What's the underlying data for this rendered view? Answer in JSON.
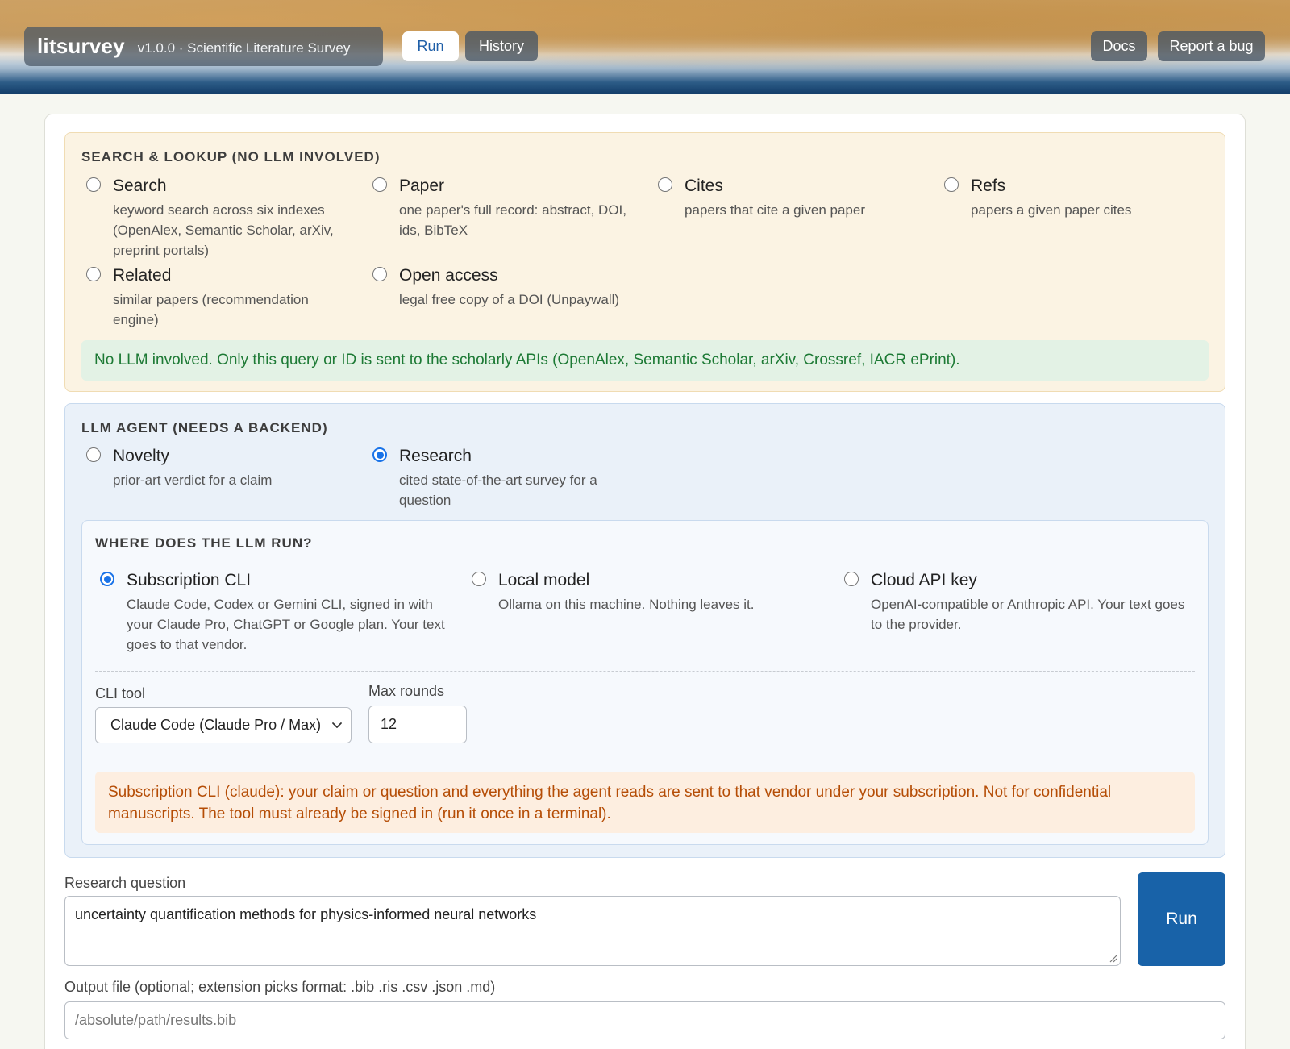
{
  "header": {
    "brand_name": "litsurvey",
    "brand_sub": "v1.0.0 · Scientific Literature Survey",
    "tabs": [
      {
        "label": "Run",
        "active": true
      },
      {
        "label": "History",
        "active": false
      }
    ],
    "links": [
      {
        "label": "Docs"
      },
      {
        "label": "Report a bug"
      }
    ]
  },
  "search_section": {
    "title": "SEARCH & LOOKUP (NO LLM INVOLVED)",
    "options": [
      {
        "label": "Search",
        "desc": "keyword search across six indexes (OpenAlex, Semantic Scholar, arXiv, preprint portals)",
        "checked": false
      },
      {
        "label": "Paper",
        "desc": "one paper's full record: abstract, DOI, ids, BibTeX",
        "checked": false
      },
      {
        "label": "Cites",
        "desc": "papers that cite a given paper",
        "checked": false
      },
      {
        "label": "Refs",
        "desc": "papers a given paper cites",
        "checked": false
      },
      {
        "label": "Related",
        "desc": "similar papers (recommendation engine)",
        "checked": false
      },
      {
        "label": "Open access",
        "desc": "legal free copy of a DOI (Unpaywall)",
        "checked": false
      }
    ],
    "note": "No LLM involved. Only this query or ID is sent to the scholarly APIs (OpenAlex, Semantic Scholar, arXiv, Crossref, IACR ePrint)."
  },
  "llm_section": {
    "title": "LLM AGENT (NEEDS A BACKEND)",
    "options": [
      {
        "label": "Novelty",
        "desc": "prior-art verdict for a claim",
        "checked": false
      },
      {
        "label": "Research",
        "desc": "cited state-of-the-art survey for a question",
        "checked": true
      }
    ],
    "where": {
      "title": "WHERE DOES THE LLM RUN?",
      "options": [
        {
          "label": "Subscription CLI",
          "desc": "Claude Code, Codex or Gemini CLI, signed in with your Claude Pro, ChatGPT or Google plan. Your text goes to that vendor.",
          "checked": true
        },
        {
          "label": "Local model",
          "desc": "Ollama on this machine. Nothing leaves it.",
          "checked": false
        },
        {
          "label": "Cloud API key",
          "desc": "OpenAI-compatible or Anthropic API. Your text goes to the provider.",
          "checked": false
        }
      ],
      "cli_tool_label": "CLI tool",
      "cli_tool_value": "Claude Code (Claude Pro / Max)",
      "max_rounds_label": "Max rounds",
      "max_rounds_value": "12",
      "warning": "Subscription CLI (claude): your claim or question and everything the agent reads are sent to that vendor under your subscription. Not for confidential manuscripts. The tool must already be signed in (run it once in a terminal)."
    }
  },
  "question": {
    "label": "Research question",
    "value": "uncertainty quantification methods for physics-informed neural networks",
    "run_label": "Run"
  },
  "output_file": {
    "label": "Output file (optional; extension picks format: .bib .ris .csv .json .md)",
    "placeholder": "/absolute/path/results.bib"
  },
  "colors": {
    "accent": "#1a73e8",
    "run_button": "#1862a8",
    "note_green_text": "#1d7a35",
    "note_orange_text": "#b54d06"
  }
}
